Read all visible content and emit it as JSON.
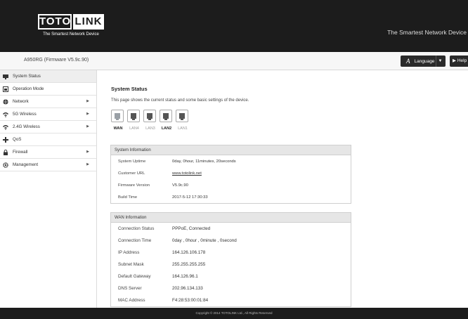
{
  "header": {
    "logo_left": "TOTO",
    "logo_right": "LINK",
    "logo_tagline": "The Smartest Network Device",
    "slogan": "The Smartest Network Device"
  },
  "subbar": {
    "model": "A950RG (Firmware V5.9c.90)",
    "language_icon": "A",
    "language_label": "Language",
    "language_caret": "▼",
    "help_label": "Help"
  },
  "sidebar": {
    "items": [
      {
        "label": "System Status",
        "icon": "status-icon",
        "arrow": ""
      },
      {
        "label": "Operation Mode",
        "icon": "operation-mode-icon",
        "arrow": ""
      },
      {
        "label": "Network",
        "icon": "globe-icon",
        "arrow": "▶"
      },
      {
        "label": "5G Wireless",
        "icon": "wifi-icon",
        "arrow": "▶"
      },
      {
        "label": "2.4G Wireless",
        "icon": "wifi-icon",
        "arrow": "▶"
      },
      {
        "label": "QoS",
        "icon": "qos-icon",
        "arrow": ""
      },
      {
        "label": "Firewall",
        "icon": "lock-icon",
        "arrow": "▶"
      },
      {
        "label": "Management",
        "icon": "gear-icon",
        "arrow": "▶"
      }
    ]
  },
  "main": {
    "title": "System Status",
    "description": "This page shows the current status and some basic settings of the device.",
    "ports": [
      {
        "label": "WAN",
        "state": "on"
      },
      {
        "label": "LAN4",
        "state": "off"
      },
      {
        "label": "LAN3",
        "state": "off"
      },
      {
        "label": "LAN2",
        "state": "on"
      },
      {
        "label": "LAN1",
        "state": "off"
      }
    ],
    "system_info": {
      "title": "System Information",
      "rows": [
        {
          "key": "System Uptime",
          "value": "0day, 0hour, 11minutes, 20seconds"
        },
        {
          "key": "Customer URL",
          "value": "www.totolink.net"
        },
        {
          "key": "Firmware Version",
          "value": "V5.9c.90"
        },
        {
          "key": "Build Time",
          "value": "2017-5-12 17:30:33"
        }
      ]
    },
    "wan_info": {
      "title": "WAN Information",
      "rows": [
        {
          "key": "Connection Status",
          "value": "PPPoE, Connected"
        },
        {
          "key": "Connection Time",
          "value": "0day , 0hour , 0minute , 0second"
        },
        {
          "key": "IP Address",
          "value": "164.126.106.178"
        },
        {
          "key": "Subnet Mask",
          "value": "255.255.255.255"
        },
        {
          "key": "Default Gateway",
          "value": "164.126.96.1"
        },
        {
          "key": "DNS Server",
          "value": "202.96.134.133"
        },
        {
          "key": "MAC Address",
          "value": "F4:28:53:00:01:84"
        }
      ]
    }
  },
  "footer": {
    "text": "Copyright © 2014 TOTOLINK Ltd.,  All Rights Reserved"
  }
}
